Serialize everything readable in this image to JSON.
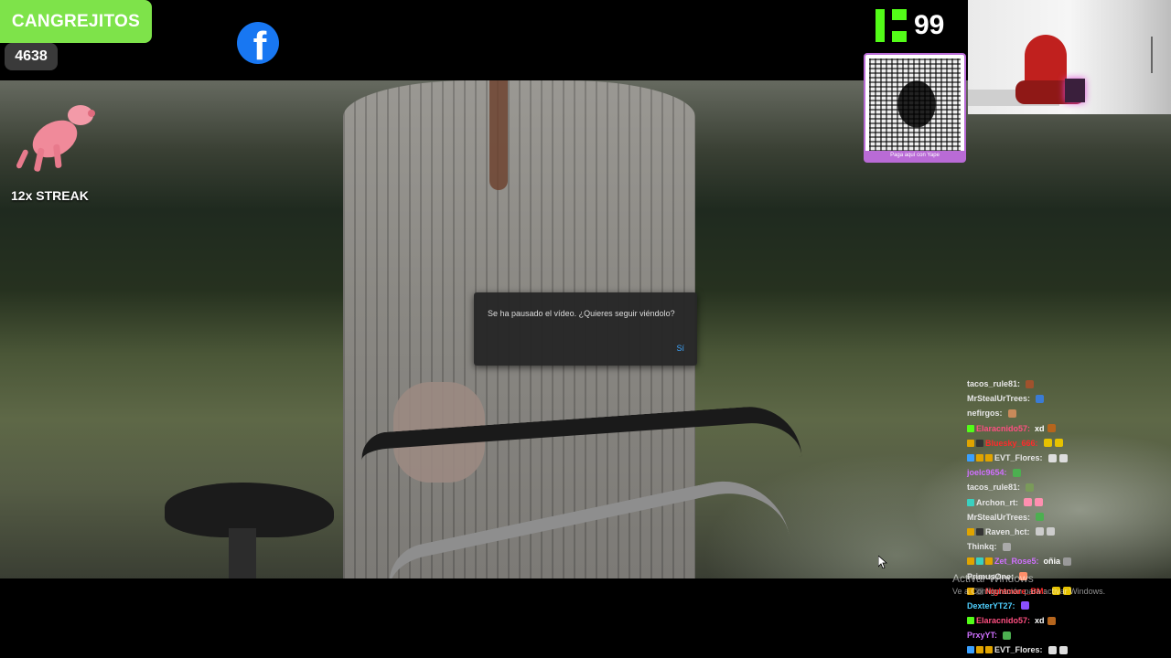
{
  "overlay": {
    "brand_label": "CANGREJITOS",
    "counter_value": "4638",
    "streak_label": "12x STREAK",
    "facebook_letter": "f",
    "kick_count": "99",
    "qr_caption": "Paga aquí con Yape"
  },
  "dialog": {
    "message": "Se ha pausado el vídeo. ¿Quieres seguir viéndolo?",
    "confirm_label": "Sí"
  },
  "chat": {
    "messages": [
      {
        "user": "tacos_rule81:",
        "color": "#e6e6e6",
        "badges": [],
        "text": "",
        "emotes": [
          "#a0522d"
        ]
      },
      {
        "user": "MrStealUrTrees:",
        "color": "#e6e6e6",
        "badges": [],
        "text": "",
        "emotes": [
          "#3a7bd5"
        ]
      },
      {
        "user": "nefirgos:",
        "color": "#e6e6e6",
        "badges": [],
        "text": "",
        "emotes": [
          "#c98a5a"
        ]
      },
      {
        "user": "Elaracnido57:",
        "color": "#ff4f81",
        "badges": [
          "#53fc18"
        ],
        "text": "xd",
        "emotes": [
          "#b5651d"
        ]
      },
      {
        "user": "Bluesky_666:",
        "color": "#ff2a2a",
        "badges": [
          "#e0a400",
          "#333333"
        ],
        "text": "",
        "emotes": [
          "#e6c200",
          "#e6c200"
        ]
      },
      {
        "user": "EVT_Flores:",
        "color": "#e6e6e6",
        "badges": [
          "#3aa0ff",
          "#e0a400",
          "#e0a400"
        ],
        "text": "",
        "emotes": [
          "#dddddd",
          "#dddddd"
        ]
      },
      {
        "user": "joelc9654:",
        "color": "#d070ff",
        "badges": [],
        "text": "",
        "emotes": [
          "#4caf50"
        ]
      },
      {
        "user": "tacos_rule81:",
        "color": "#e6e6e6",
        "badges": [],
        "text": "",
        "emotes": [
          "#7a9a5a"
        ]
      },
      {
        "user": "Archon_rt:",
        "color": "#e6e6e6",
        "badges": [
          "#3ad0c0"
        ],
        "text": "",
        "emotes": [
          "#ff8fb0",
          "#ff8fb0"
        ]
      },
      {
        "user": "MrStealUrTrees:",
        "color": "#e6e6e6",
        "badges": [],
        "text": "",
        "emotes": [
          "#4caf50"
        ]
      },
      {
        "user": "Raven_hct:",
        "color": "#e6e6e6",
        "badges": [
          "#e0a400",
          "#333333"
        ],
        "text": "",
        "emotes": [
          "#cccccc",
          "#cccccc"
        ]
      },
      {
        "user": "Thinkq:",
        "color": "#e6e6e6",
        "badges": [],
        "text": "",
        "emotes": [
          "#aaaaaa"
        ]
      },
      {
        "user": "Zet_Rose5:",
        "color": "#d070ff",
        "badges": [
          "#e0a400",
          "#3ad0c0",
          "#e0a400"
        ],
        "text": "oñia",
        "emotes": [
          "#999999"
        ]
      },
      {
        "user": "PrimusOne:",
        "color": "#e6e6e6",
        "badges": [],
        "text": "",
        "emotes": [
          "#ff8f6a"
        ]
      },
      {
        "user": "Nightmare_BM:",
        "color": "#ff2a2a",
        "badges": [
          "#e0a400",
          "#333333"
        ],
        "text": "",
        "emotes": [
          "#e6c200",
          "#e6c200"
        ]
      },
      {
        "user": "DexterYT27:",
        "color": "#4fd0ff",
        "badges": [],
        "text": "",
        "emotes": [
          "#8a4fff"
        ]
      },
      {
        "user": "Elaracnido57:",
        "color": "#ff4f81",
        "badges": [
          "#53fc18"
        ],
        "text": "xd",
        "emotes": [
          "#b5651d"
        ]
      },
      {
        "user": "PrxyYT:",
        "color": "#d070ff",
        "badges": [],
        "text": "",
        "emotes": [
          "#4caf50"
        ]
      },
      {
        "user": "EVT_Flores:",
        "color": "#e6e6e6",
        "badges": [
          "#3aa0ff",
          "#e0a400",
          "#e0a400"
        ],
        "text": "",
        "emotes": [
          "#dddddd",
          "#dddddd"
        ]
      }
    ]
  },
  "watermark": {
    "title": "Activar Windows",
    "subtitle": "Ve a Configuración para activar Windows."
  },
  "colors": {
    "brand_green": "#7ee34a",
    "kick_green": "#53fc18",
    "facebook_blue": "#1877f2",
    "dialog_button": "#3ea6ff",
    "qr_border": "#b96bd6"
  }
}
